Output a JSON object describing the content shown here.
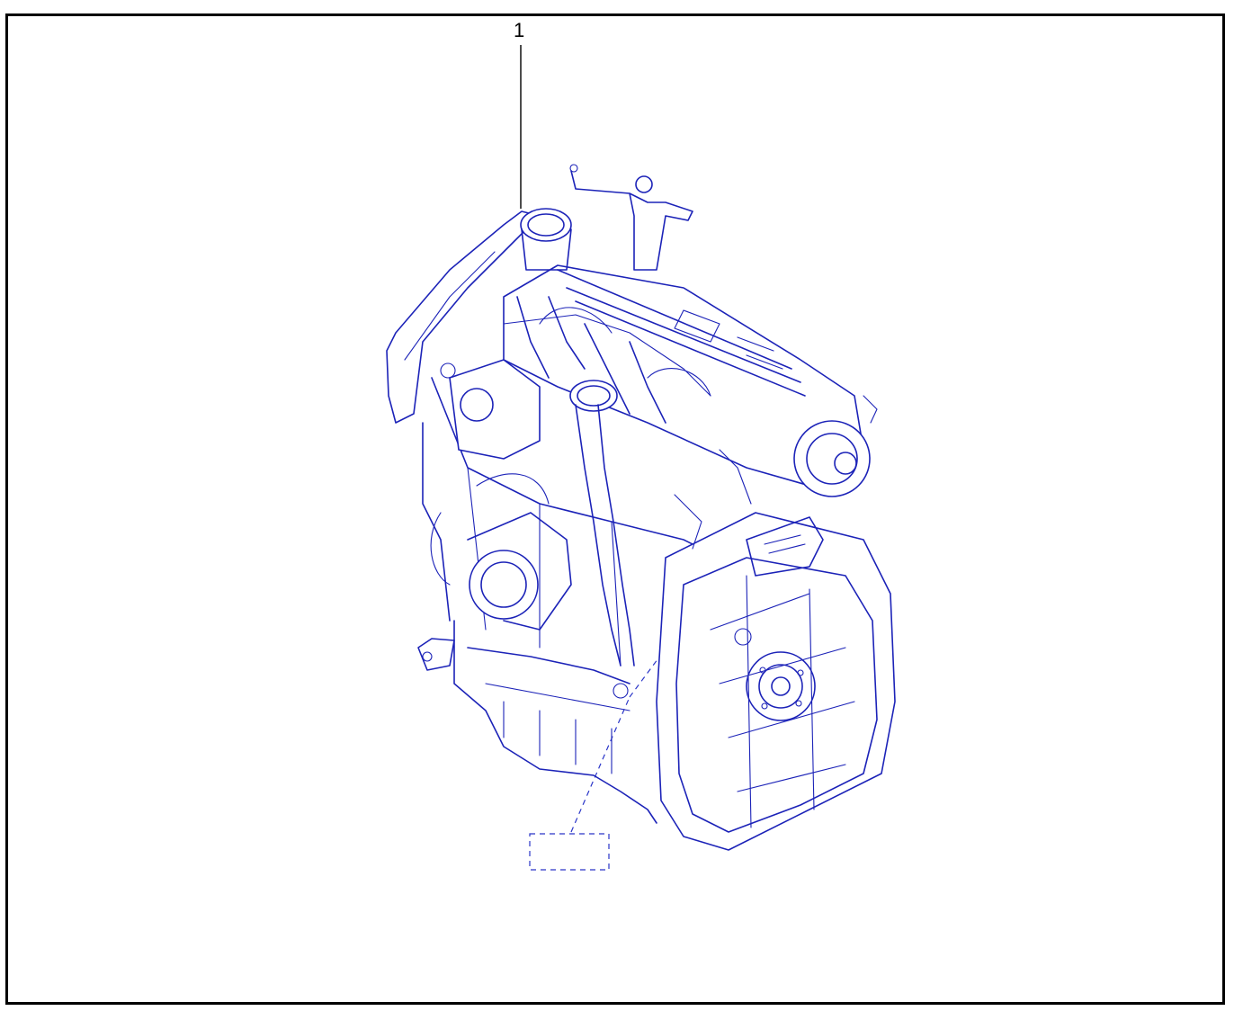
{
  "diagram": {
    "callout_label": "1",
    "line_color": "#1c23b8",
    "frame_color": "#000000"
  }
}
